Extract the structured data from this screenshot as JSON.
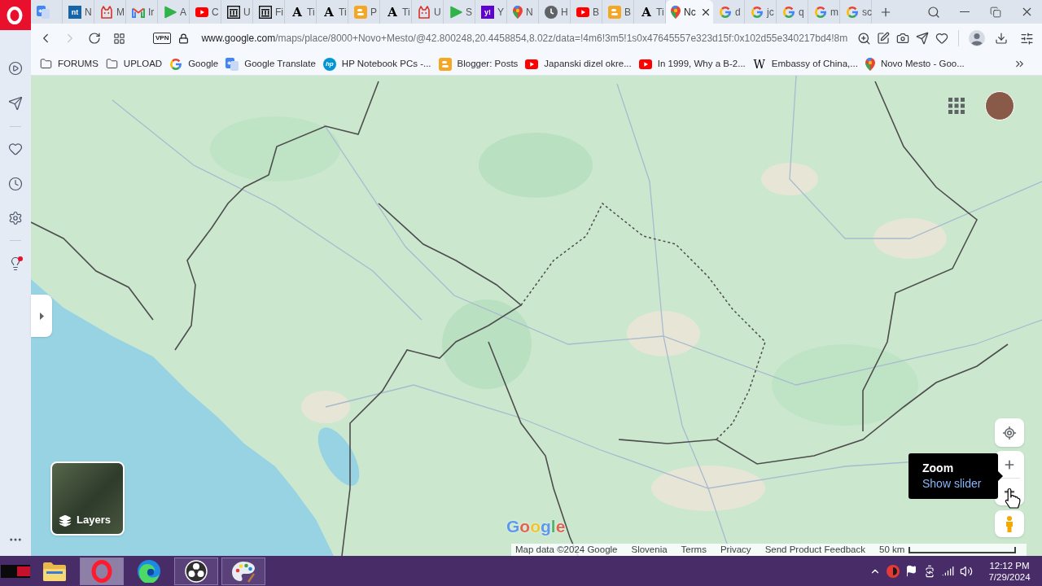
{
  "browser": {
    "tabs": [
      {
        "kind": "translate",
        "selected": false
      },
      {
        "kind": "letters",
        "icon_text": "nt",
        "label": "N",
        "selected": false
      },
      {
        "kind": "cat",
        "label": "M",
        "selected": false
      },
      {
        "kind": "mail",
        "label": "Ir",
        "selected": false
      },
      {
        "kind": "play",
        "label": "A",
        "selected": false
      },
      {
        "kind": "video",
        "label": "C",
        "selected": false
      },
      {
        "kind": "building",
        "label": "U",
        "selected": false
      },
      {
        "kind": "building",
        "label": "Fi",
        "selected": false
      },
      {
        "kind": "gothic",
        "icon_text": "A",
        "label": "Ti",
        "selected": false
      },
      {
        "kind": "gothic",
        "icon_text": "A",
        "label": "Ti",
        "selected": false
      },
      {
        "kind": "blog",
        "label": "P",
        "selected": false
      },
      {
        "kind": "gothic",
        "icon_text": "A",
        "label": "Ti",
        "selected": false
      },
      {
        "kind": "cat",
        "label": "U",
        "selected": false
      },
      {
        "kind": "play",
        "label": "S",
        "selected": false
      },
      {
        "kind": "yahoo",
        "icon_text": "y!",
        "label": "Y",
        "selected": false
      },
      {
        "kind": "pin",
        "label": "N",
        "selected": false
      },
      {
        "kind": "clock",
        "label": "H",
        "selected": false
      },
      {
        "kind": "video",
        "label": "B",
        "selected": false
      },
      {
        "kind": "blog",
        "label": "B",
        "selected": false
      },
      {
        "kind": "gothic",
        "icon_text": "A",
        "label": "Ti",
        "selected": false
      },
      {
        "kind": "pin",
        "label": "Nc",
        "selected": true
      },
      {
        "kind": "g",
        "label": "d",
        "selected": false
      },
      {
        "kind": "g",
        "label": "jc",
        "selected": false
      },
      {
        "kind": "g",
        "label": "q",
        "selected": false
      },
      {
        "kind": "g",
        "label": "m",
        "selected": false
      },
      {
        "kind": "g",
        "label": "sc",
        "selected": false
      }
    ],
    "toolbar": {
      "back": {
        "disabled": false
      },
      "forward": {
        "disabled": true
      },
      "vpn": "VPN",
      "url": {
        "host": "www.google.com",
        "path": "/maps/place/8000+Novo+Mesto/@42.800248,20.4458854,8.02z/data=!4m6!3m5!1s0x47645557e323d15f:0x102d55e340217bd4!8m"
      }
    },
    "bookmarks": [
      {
        "kind": "folder",
        "label": "FORUMS"
      },
      {
        "kind": "folder",
        "label": "UPLOAD"
      },
      {
        "kind": "g",
        "label": "Google"
      },
      {
        "kind": "translate",
        "label": "Google Translate"
      },
      {
        "kind": "hp",
        "icon_text": "hp",
        "label": "HP Notebook PCs -..."
      },
      {
        "kind": "blog",
        "label": "Blogger: Posts"
      },
      {
        "kind": "video",
        "label": "Japanski dizel okre..."
      },
      {
        "kind": "video",
        "label": "In 1999, Why a B-2..."
      },
      {
        "kind": "wiki",
        "icon_text": "W",
        "label": "Embassy of China,..."
      },
      {
        "kind": "pin",
        "label": "Novo Mesto - Goo..."
      }
    ]
  },
  "map": {
    "logo": "Google",
    "layers": {
      "label": "Layers"
    },
    "tooltip": {
      "title": "Zoom",
      "link": "Show slider"
    },
    "footer": [
      "Map data ©2024 Google",
      "Slovenia",
      "Terms",
      "Privacy",
      "Send Product Feedback"
    ],
    "scale": "50 km"
  },
  "taskbar": {
    "apps": [
      {
        "kind": "window",
        "running": false,
        "selected": false
      },
      {
        "kind": "explorer",
        "running": false,
        "selected": false
      },
      {
        "kind": "browser",
        "running": true,
        "selected": true
      },
      {
        "kind": "edge",
        "running": false,
        "selected": false
      },
      {
        "kind": "obs",
        "running": true,
        "selected": false
      },
      {
        "kind": "paint",
        "running": true,
        "selected": false
      }
    ],
    "time": "12:12 PM",
    "date": "7/29/2024"
  }
}
